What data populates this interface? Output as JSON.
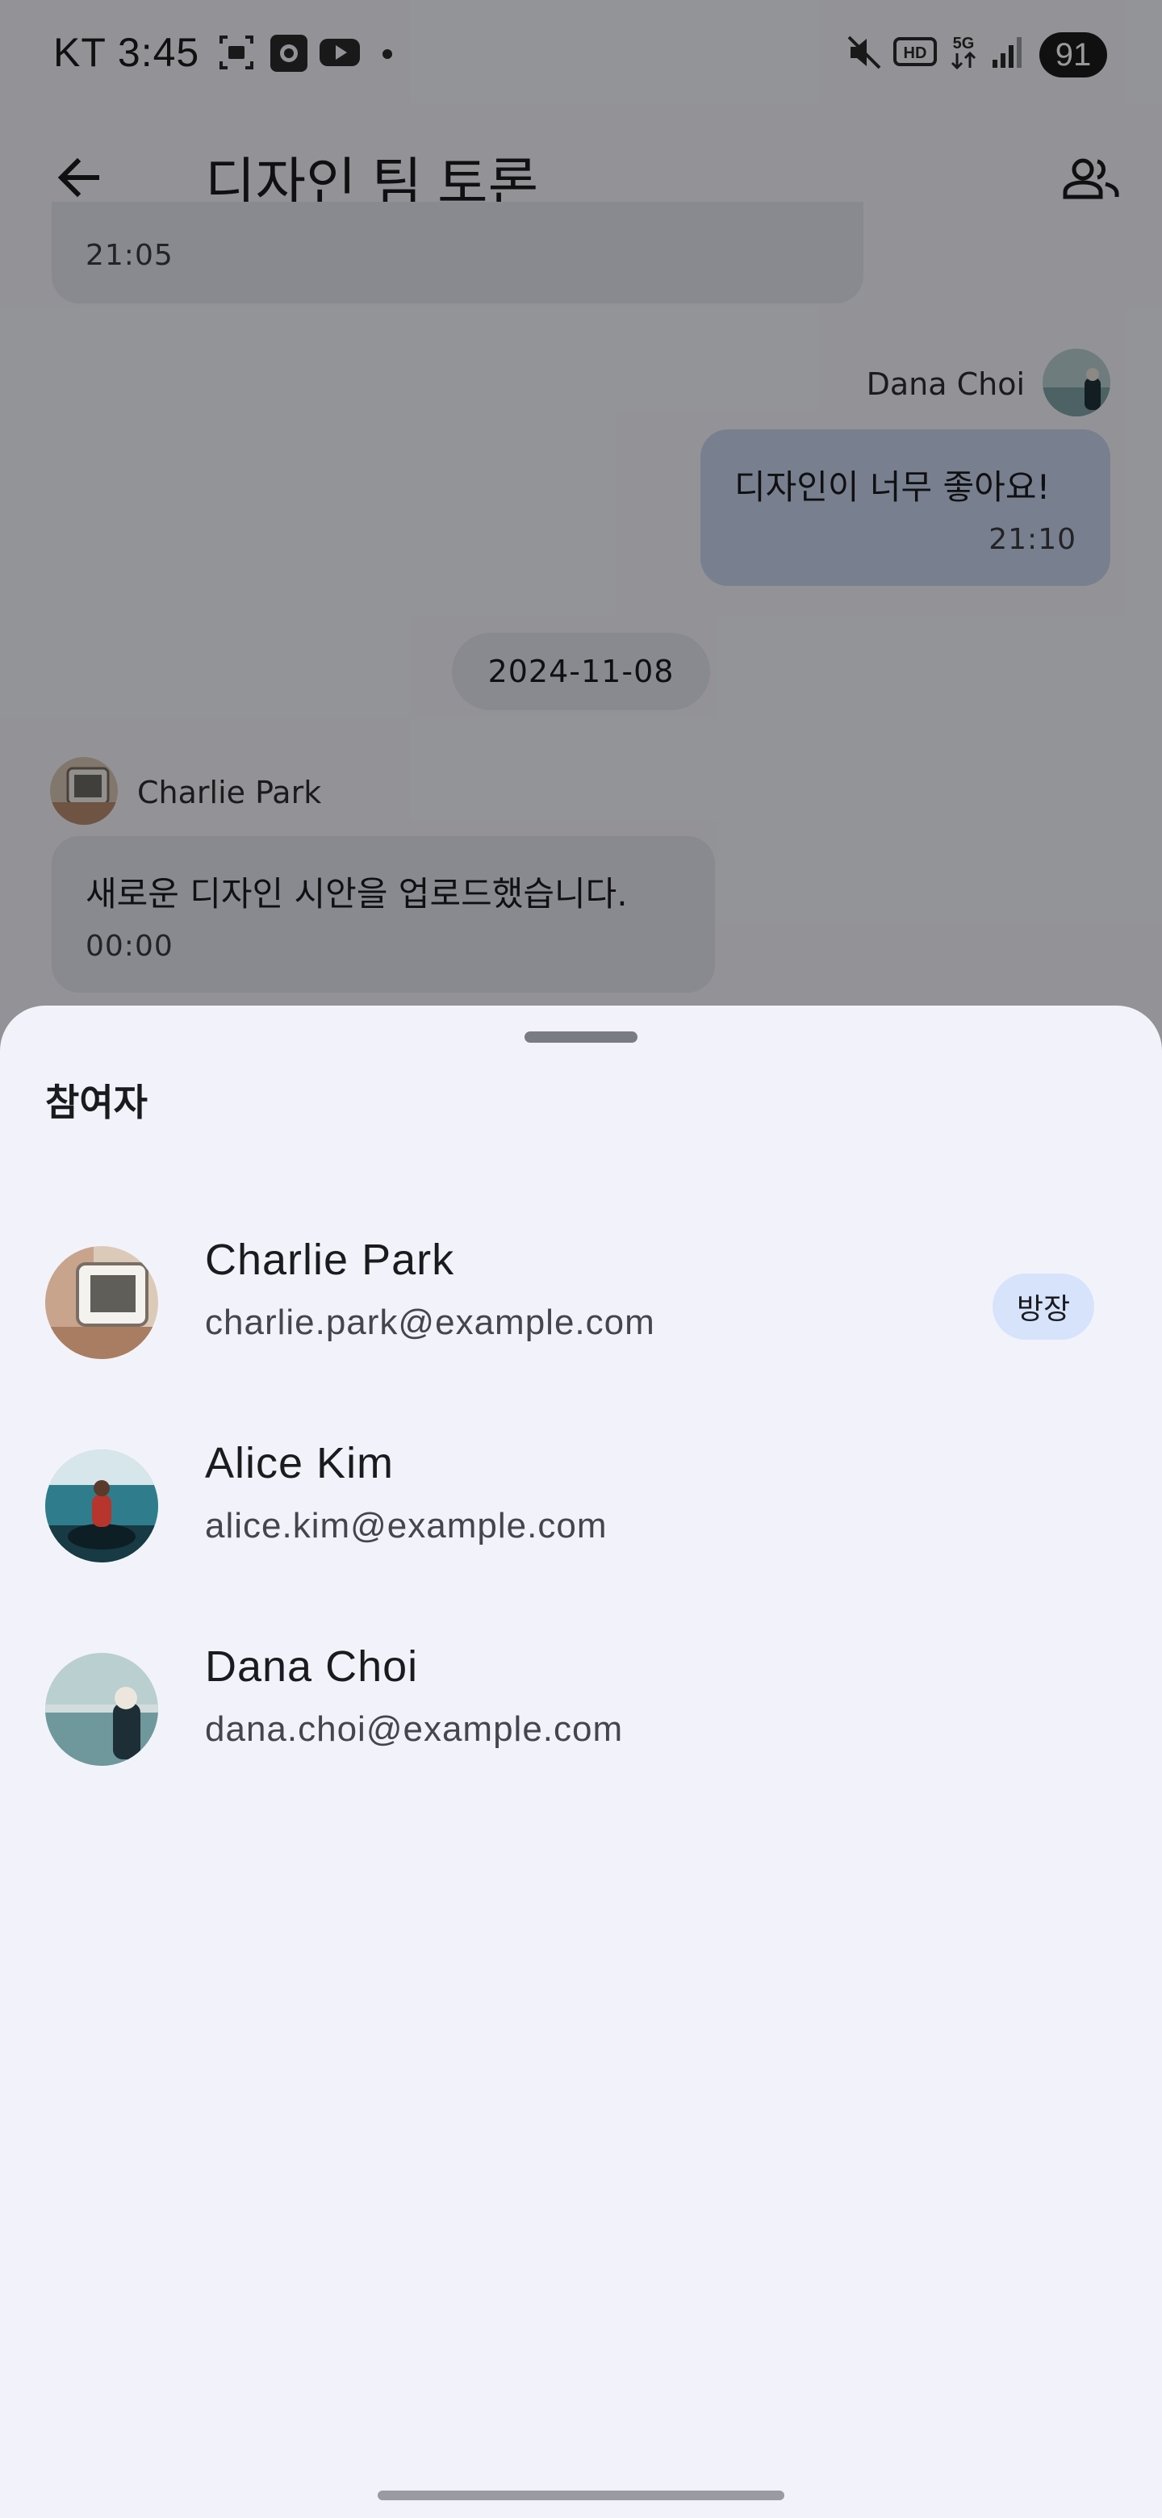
{
  "status_bar": {
    "time": "KT 3:45",
    "battery": "91",
    "icons": [
      "screenshot-icon",
      "screen-record-icon",
      "youtube-icon",
      "dot-icon",
      "mute-icon",
      "hd-icon",
      "5g-icon",
      "signal-icon",
      "battery-icon"
    ]
  },
  "app_bar": {
    "title": "디자인 팀 토론",
    "back_icon": "arrow-back-icon",
    "participants_icon": "people-icon"
  },
  "chat": {
    "partial_time": "21:05",
    "messages": [
      {
        "sender": "Dana Choi",
        "text": "디자인이 너무 좋아요!",
        "time": "21:10",
        "mine": true
      },
      {
        "sender": "Charlie Park",
        "text": "새로운 디자인 시안을 업로드했습니다.",
        "time": "00:00",
        "mine": false
      }
    ],
    "date_divider": "2024-11-08"
  },
  "sheet": {
    "title": "참여자",
    "participants": [
      {
        "name": "Charlie Park",
        "email": "charlie.park@example.com",
        "badge": "방장"
      },
      {
        "name": "Alice Kim",
        "email": "alice.kim@example.com"
      },
      {
        "name": "Dana Choi",
        "email": "dana.choi@example.com"
      }
    ]
  },
  "colors": {
    "sheet_bg": "#f2f3fa",
    "my_bubble": "#c9d5ef",
    "other_bubble": "#e5e6ee",
    "owner_badge": "#d6e3fb"
  }
}
